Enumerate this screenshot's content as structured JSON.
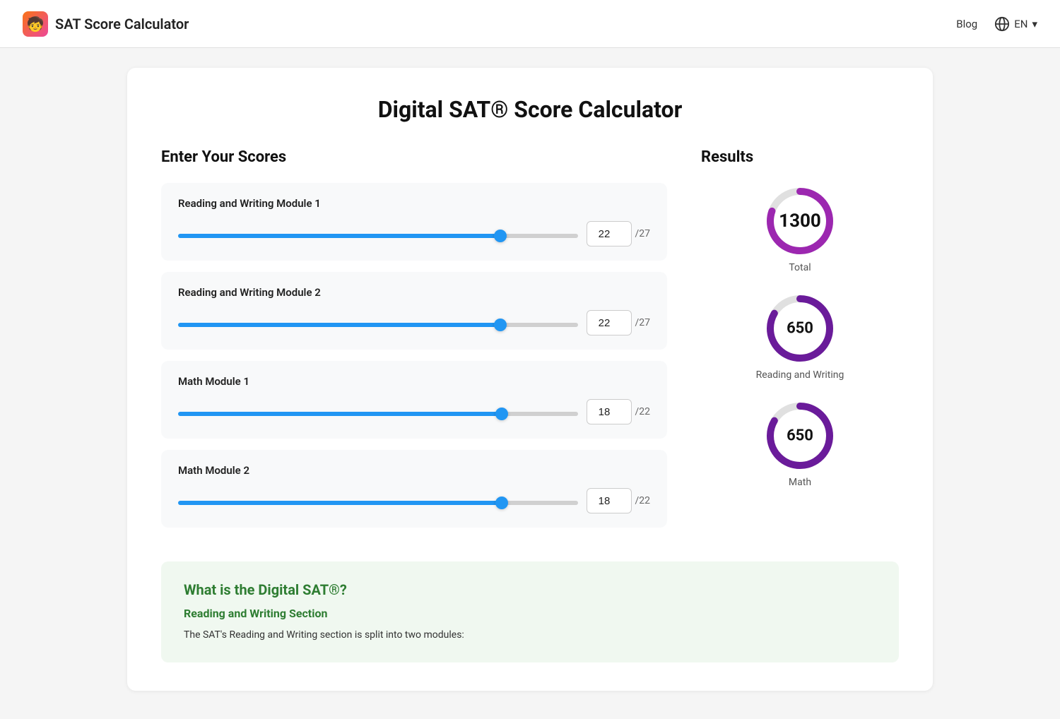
{
  "navbar": {
    "brand_icon": "🧒",
    "brand_name": "SAT Score Calculator",
    "blog_label": "Blog",
    "lang_label": "EN",
    "lang_chevron": "▾"
  },
  "page": {
    "title": "Digital SAT® Score Calculator"
  },
  "left": {
    "heading": "Enter Your Scores",
    "modules": [
      {
        "id": "rw1",
        "title": "Reading and Writing Module 1",
        "value": "22",
        "max": "/27",
        "slider_pct": 75
      },
      {
        "id": "rw2",
        "title": "Reading and Writing Module 2",
        "value": "22",
        "max": "/27",
        "slider_pct": 75
      },
      {
        "id": "m1",
        "title": "Math Module 1",
        "value": "18",
        "max": "/22",
        "slider_pct": 75
      },
      {
        "id": "m2",
        "title": "Math Module 2",
        "value": "18",
        "max": "/22",
        "slider_pct": 75
      }
    ]
  },
  "right": {
    "heading": "Results",
    "total": {
      "score": "1300",
      "label": "Total",
      "circumference": 283,
      "fill": 212
    },
    "reading_writing": {
      "score": "650",
      "label": "Reading and Writing",
      "circumference": 283,
      "fill": 200
    },
    "math": {
      "score": "650",
      "label": "Math",
      "circumference": 283,
      "fill": 200
    }
  },
  "info": {
    "title": "What is the Digital SAT®?",
    "subtitle": "Reading and Writing Section",
    "text": "The SAT's Reading and Writing section is split into two modules:"
  }
}
